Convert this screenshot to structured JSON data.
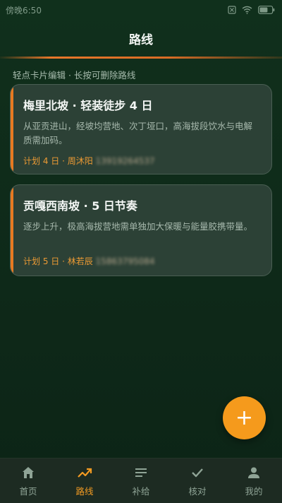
{
  "status_bar": {
    "time": "傍晚6:50",
    "battery_level": 0.65
  },
  "header": {
    "title": "路线"
  },
  "hint": "轻点卡片编辑 · 长按可删除路线",
  "routes": [
    {
      "title": "梅里北坡 · 轻装徒步 4 日",
      "description": "从亚贡进山，经坡均营地、次丁垭口，高海拔段饮水与电解质需加码。",
      "meta_prefix": "计划 4 日 · 周沐阳",
      "phone": "13919264537"
    },
    {
      "title": "贡嘎西南坡 · 5 日节奏",
      "description": "逐步上升，极高海拔营地需单独加大保暖与能量胶携带量。",
      "meta_prefix": "计划 5 日 · 林若辰",
      "phone": "15863795084"
    }
  ],
  "fab": {
    "label": "+"
  },
  "bottom_nav": {
    "items": [
      {
        "label": "首页",
        "icon": "home-icon",
        "active": false
      },
      {
        "label": "路线",
        "icon": "trending-up-icon",
        "active": true
      },
      {
        "label": "补给",
        "icon": "list-icon",
        "active": false
      },
      {
        "label": "核对",
        "icon": "check-icon",
        "active": false
      },
      {
        "label": "我的",
        "icon": "person-icon",
        "active": false
      }
    ]
  },
  "colors": {
    "accent": "#f59a1c",
    "card_bg": "#2c4136",
    "background": "#0f2b1a"
  }
}
